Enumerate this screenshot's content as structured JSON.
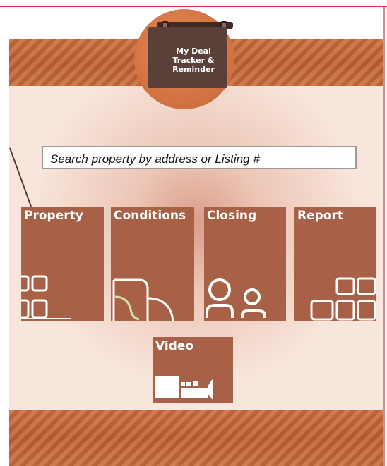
{
  "app": {
    "logo_text": "My Deal\nTracker &\nReminder"
  },
  "search": {
    "placeholder": "Search property by address or Listing #"
  },
  "tiles": {
    "property": {
      "label": "Property",
      "icon": "grid-icon"
    },
    "conditions": {
      "label": "Conditions",
      "icon": "document-icon"
    },
    "closing": {
      "label": "Closing",
      "icon": "people-icon"
    },
    "report": {
      "label": "Report",
      "icon": "report-grid-icon"
    },
    "video": {
      "label": "Video",
      "icon": "video-camera-icon"
    }
  },
  "colors": {
    "tile": "#a86147",
    "band": "#bd6235",
    "accent_line": "#e23a3a"
  }
}
